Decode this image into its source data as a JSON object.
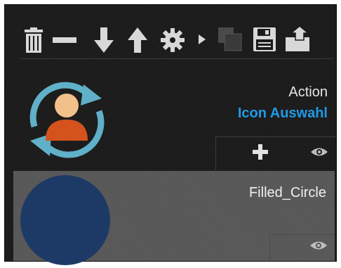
{
  "toolbar": {
    "icons": [
      "trash-icon",
      "minus-icon",
      "arrow-down-icon",
      "arrow-up-icon",
      "gear-icon",
      "chevron-right-icon",
      "copy-icon",
      "save-icon",
      "export-icon"
    ]
  },
  "action_item": {
    "title": "Action",
    "subtitle": "Icon Auswahl",
    "icon": "user-sync-icon",
    "subtitle_color": "#1f9ae6"
  },
  "circle_item": {
    "title": "Filled_Circle",
    "fill_color": "#1d3a66"
  },
  "colors": {
    "panel_bg": "#1b1b1b",
    "selected_row_bg": "#575757",
    "icon_color": "#d8d8d8"
  }
}
